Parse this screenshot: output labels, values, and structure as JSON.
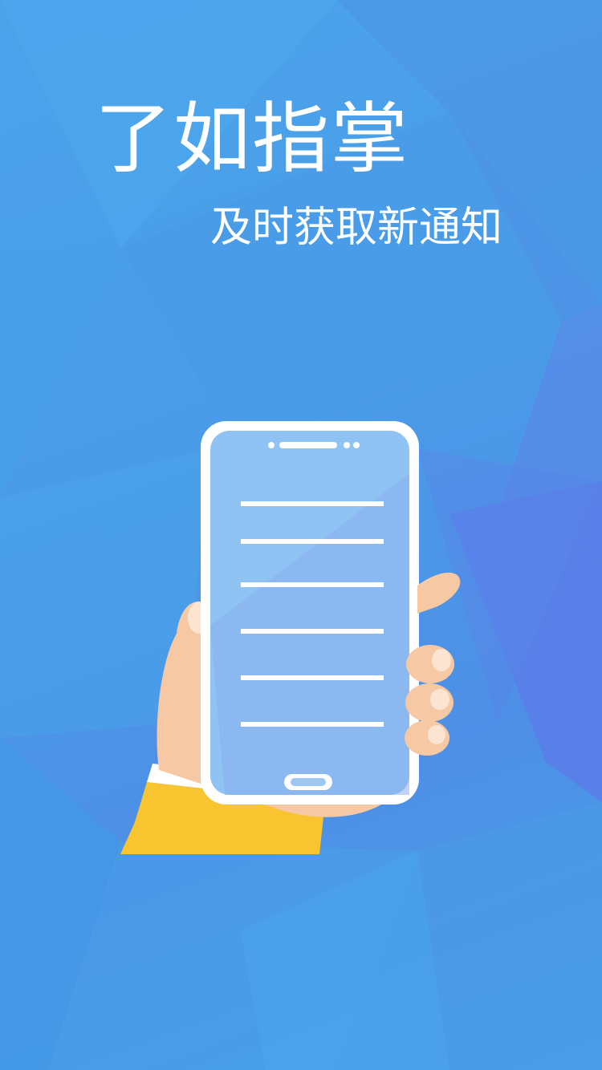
{
  "splash": {
    "title": "了如指掌",
    "subtitle": "及时获取新通知"
  },
  "illustration": {
    "icon": "hand-holding-phone-icon",
    "list_lines": 6
  },
  "colors": {
    "background": "#4a9fe6",
    "phone_frame": "#ffffff",
    "phone_screen": "#8ec3f3",
    "skin": "#f6c9a4",
    "skin_shadow": "#f0a67d",
    "cuff": "#ffffff",
    "sleeve": "#f8c531"
  }
}
